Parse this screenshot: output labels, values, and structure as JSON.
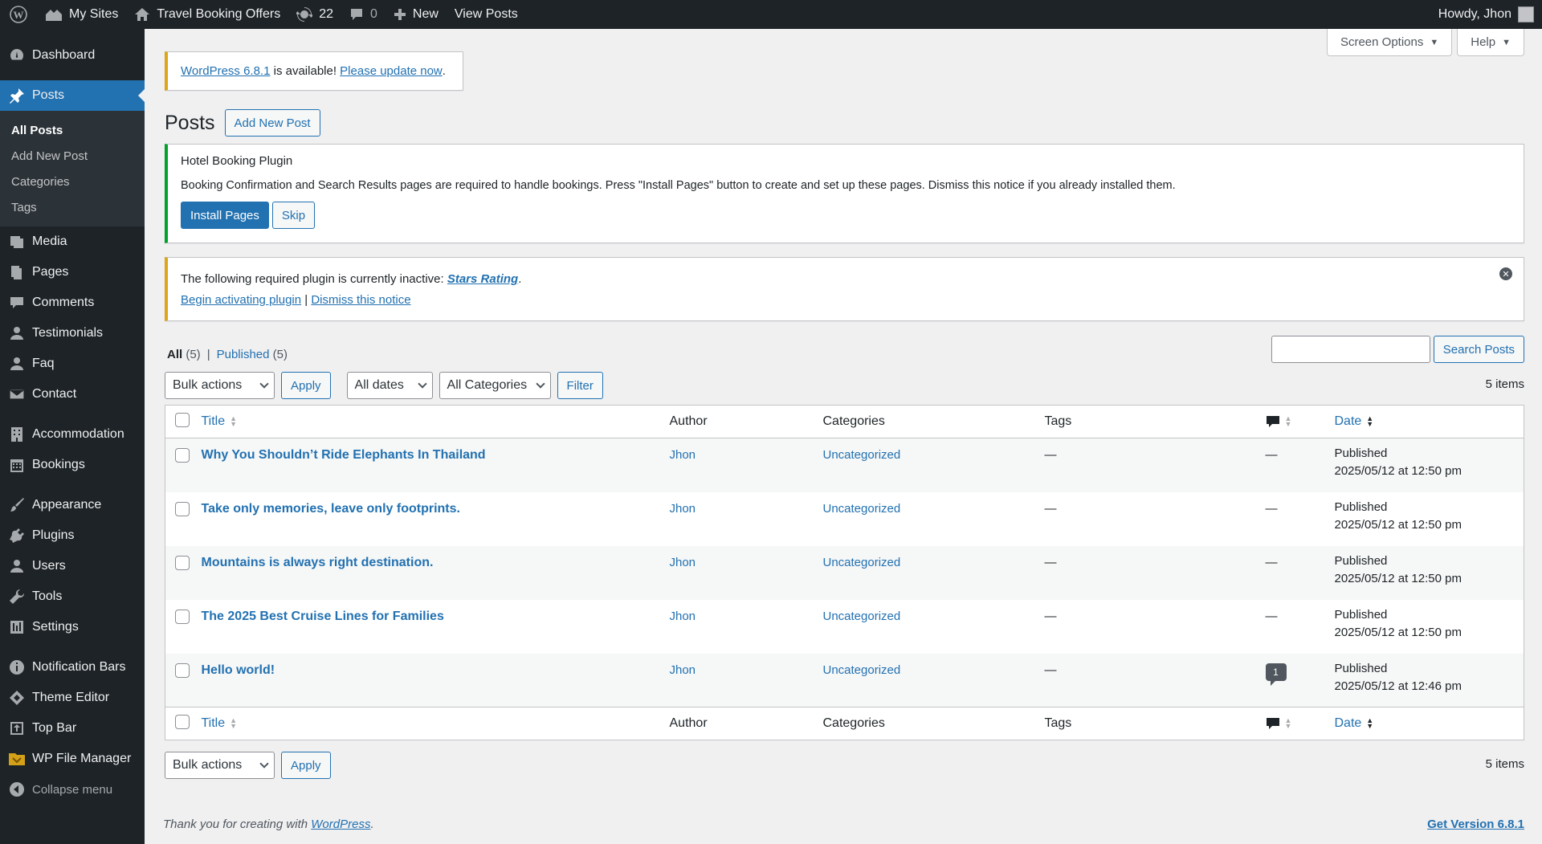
{
  "adminbar": {
    "my_sites": "My Sites",
    "site_name": "Travel Booking Offers",
    "updates_count": "22",
    "comments_count": "0",
    "new_label": "New",
    "view_posts": "View Posts",
    "howdy": "Howdy, Jhon"
  },
  "sidebar": {
    "dashboard": "Dashboard",
    "posts": "Posts",
    "submenu": [
      "All Posts",
      "Add New Post",
      "Categories",
      "Tags"
    ],
    "items_a": [
      "Media",
      "Pages",
      "Comments",
      "Testimonials",
      "Faq",
      "Contact"
    ],
    "items_b": [
      "Accommodation",
      "Bookings"
    ],
    "items_c": [
      "Appearance",
      "Plugins",
      "Users",
      "Tools",
      "Settings"
    ],
    "items_d": [
      "Notification Bars",
      "Theme Editor",
      "Top Bar",
      "WP File Manager"
    ],
    "collapse": "Collapse menu"
  },
  "screen_meta": {
    "screen_options": "Screen Options",
    "help": "Help"
  },
  "update_notice": {
    "version_link": "WordPress 6.8.1",
    "text": " is available! ",
    "update_link": "Please update now",
    "period": "."
  },
  "page": {
    "title": "Posts",
    "add_new": "Add New Post"
  },
  "hotel_notice": {
    "title": "Hotel Booking Plugin",
    "text": "Booking Confirmation and Search Results pages are required to handle bookings. Press \"Install Pages\" button to create and set up these pages. Dismiss this notice if you already installed them.",
    "install": "Install Pages",
    "skip": "Skip"
  },
  "plugin_notice": {
    "text": "The following required plugin is currently inactive: ",
    "plugin": "Stars Rating",
    "period": ".",
    "activate": "Begin activating plugin",
    "sep": " | ",
    "dismiss": "Dismiss this notice"
  },
  "filters": {
    "all": "All",
    "all_count": "(5)",
    "sep": "|",
    "published": "Published",
    "published_count": "(5)",
    "bulk": "Bulk actions",
    "apply": "Apply",
    "dates": "All dates",
    "categories": "All Categories",
    "filter": "Filter",
    "search_button": "Search Posts",
    "search_value": "",
    "items": "5 items"
  },
  "table": {
    "columns": {
      "title": "Title",
      "author": "Author",
      "categories": "Categories",
      "tags": "Tags",
      "date": "Date"
    },
    "rows": [
      {
        "title": "Why You Shouldn’t Ride Elephants In Thailand",
        "author": "Jhon",
        "category": "Uncategorized",
        "tags": "—",
        "comments": "—",
        "status": "Published",
        "date": "2025/05/12 at 12:50 pm"
      },
      {
        "title": "Take only memories, leave only footprints.",
        "author": "Jhon",
        "category": "Uncategorized",
        "tags": "—",
        "comments": "—",
        "status": "Published",
        "date": "2025/05/12 at 12:50 pm"
      },
      {
        "title": "Mountains is always right destination.",
        "author": "Jhon",
        "category": "Uncategorized",
        "tags": "—",
        "comments": "—",
        "status": "Published",
        "date": "2025/05/12 at 12:50 pm"
      },
      {
        "title": "The 2025 Best Cruise Lines for Families",
        "author": "Jhon",
        "category": "Uncategorized",
        "tags": "—",
        "comments": "—",
        "status": "Published",
        "date": "2025/05/12 at 12:50 pm"
      },
      {
        "title": "Hello world!",
        "author": "Jhon",
        "category": "Uncategorized",
        "tags": "—",
        "comments": "1",
        "status": "Published",
        "date": "2025/05/12 at 12:46 pm"
      }
    ]
  },
  "footer": {
    "thanks": "Thank you for creating with ",
    "wp": "WordPress",
    "period": ".",
    "version": "Get Version 6.8.1"
  },
  "colors": {
    "accent": "#2271b1",
    "sidebar": "#1d2327",
    "warning": "#dba617",
    "success": "#00a32a"
  }
}
